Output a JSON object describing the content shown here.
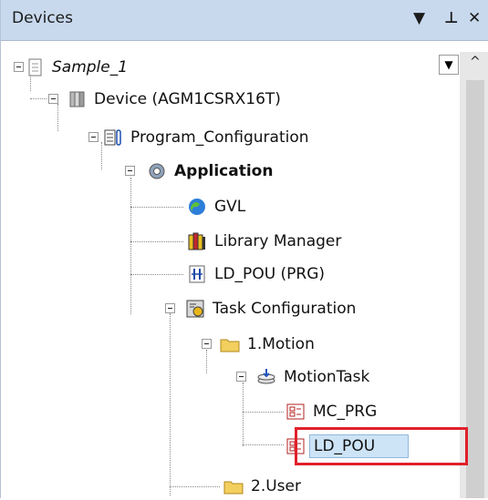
{
  "panel": {
    "title": "Devices",
    "dropdown_glyph": "▼",
    "pin_glyph": "⊥",
    "close_glyph": "✕"
  },
  "scroll": {
    "down_glyph": "▼",
    "up_glyph": "^"
  },
  "tree": {
    "sample": "Sample_1",
    "device": "Device (AGM1CSRX16T)",
    "program_configuration": "Program_Configuration",
    "application": "Application",
    "gvl": "GVL",
    "library_manager": "Library Manager",
    "ld_pou_prg": "LD_POU (PRG)",
    "task_configuration": "Task Configuration",
    "motion_folder": "1.Motion",
    "motion_task": "MotionTask",
    "mc_prg": "MC_PRG",
    "ld_pou": "LD_POU",
    "user_folder": "2.User"
  },
  "colors": {
    "highlight": "#e0202a",
    "selection": "#cde4f7",
    "titlebar": "#c8d9ee"
  }
}
